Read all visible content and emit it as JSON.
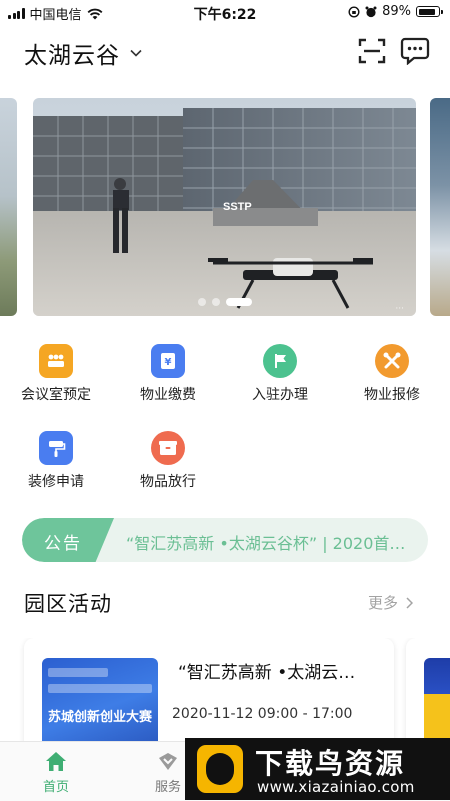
{
  "status_bar": {
    "carrier": "中国电信",
    "time": "下午6:22",
    "battery": "89%",
    "battery_level": 0.89
  },
  "header": {
    "park_name": "太湖云谷",
    "icons": [
      "chevron-down-icon",
      "scan-icon",
      "message-icon"
    ]
  },
  "banner": {
    "slide_count": 3,
    "active_slide": 3,
    "sign_text": "SSTP"
  },
  "services": [
    {
      "label": "会议室预定",
      "icon": "meeting-room-icon",
      "color": "#f5a623"
    },
    {
      "label": "物业缴费",
      "icon": "payment-icon",
      "color": "#4a7df0"
    },
    {
      "label": "入驻办理",
      "icon": "flag-icon",
      "color": "#4cc28f"
    },
    {
      "label": "物业报修",
      "icon": "repair-icon",
      "color": "#f29a2e"
    },
    {
      "label": "装修申请",
      "icon": "paint-roller-icon",
      "color": "#4a7df0"
    },
    {
      "label": "物品放行",
      "icon": "box-icon",
      "color": "#ef6b4f"
    }
  ],
  "notice": {
    "tag": "公告",
    "text": "“智汇苏高新 •太湖云谷杯” | 2020首…"
  },
  "activities": {
    "title": "园区活动",
    "more": "更多",
    "items": [
      {
        "title": "“智汇苏高新 •太湖云…",
        "time": "2020-11-12 09:00 - 17:00",
        "thumb_text": "苏城创新创业大赛"
      }
    ]
  },
  "tabbar": {
    "tabs": [
      {
        "label": "首页",
        "icon": "home-icon",
        "active": true
      },
      {
        "label": "服务",
        "icon": "service-icon",
        "active": false
      }
    ]
  },
  "watermark": {
    "title": "下载鸟资源",
    "url": "www.xiazainiao.com"
  },
  "colors": {
    "accent_green": "#3fae73",
    "notice_bg": "#eaf3ee",
    "notice_tag": "#6ec59b"
  }
}
